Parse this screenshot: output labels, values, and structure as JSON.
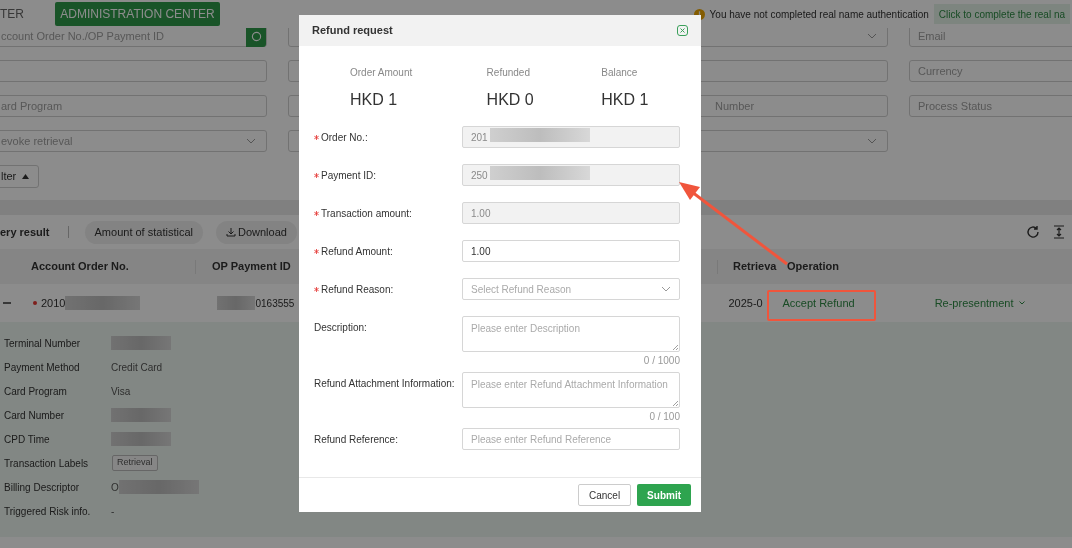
{
  "top_bar": {
    "cut_label": "TER",
    "admin_button": "ADMINISTRATION CENTER",
    "notice": "You have not completed real name authentication",
    "notice_link": "Click to complete the real na"
  },
  "filters": {
    "column_1": [
      {
        "kind": "search",
        "placeholder": "ccount Order No./OP Payment ID"
      },
      {
        "kind": "text"
      },
      {
        "kind": "text",
        "placeholder": "ard Program"
      },
      {
        "kind": "select",
        "placeholder": "evoke retrieval"
      }
    ],
    "column_3": [
      {
        "kind": "select"
      },
      {
        "kind": "text"
      },
      {
        "kind": "text",
        "placeholder": "Number"
      },
      {
        "kind": "select"
      }
    ],
    "column_4": [
      {
        "placeholder": "Email"
      },
      {
        "placeholder": "Currency"
      },
      {
        "placeholder": "Process Status"
      }
    ],
    "filter_toggle": {
      "label": "lter",
      "expanded": true
    }
  },
  "toolbar": {
    "title": "ery result",
    "buttons": [
      {
        "label": "Amount of statistical",
        "kind": "plain"
      },
      {
        "label": "Download",
        "kind": "download"
      }
    ]
  },
  "table": {
    "columns": [
      "Account Order No.",
      "OP Payment ID",
      "Retrieva",
      "Operation"
    ],
    "row": {
      "expanded": true,
      "order_no": "2010",
      "payment_id": "0163555",
      "retrieval": "2025-0",
      "actions": [
        "Accept Refund",
        "Re-presentment"
      ]
    },
    "details": [
      {
        "label": "Terminal Number",
        "kind": "redacted"
      },
      {
        "label": "Payment Method",
        "kind": "text",
        "value": "Credit Card"
      },
      {
        "label": "Card Program",
        "kind": "text",
        "value": "Visa"
      },
      {
        "label": "Card Number",
        "kind": "redacted"
      },
      {
        "label": "CPD Time",
        "kind": "redacted"
      },
      {
        "label": "Transaction Labels",
        "kind": "tag",
        "value": "Retrieval"
      },
      {
        "label": "Billing Descriptor",
        "kind": "partial",
        "value": "O"
      },
      {
        "label": "Triggered Risk info.",
        "kind": "text",
        "value": "-"
      }
    ]
  },
  "dialog": {
    "title": "Refund request",
    "summary": [
      {
        "label": "Order Amount",
        "value": "HKD 1"
      },
      {
        "label": "Refunded",
        "value": "HKD 0"
      },
      {
        "label": "Balance",
        "value": "HKD 1"
      }
    ],
    "fields": [
      {
        "label": "Order No.:",
        "required": true,
        "kind": "input",
        "disabled": true,
        "value": "201",
        "redacted": true
      },
      {
        "label": "Payment ID:",
        "required": true,
        "kind": "input",
        "disabled": true,
        "value": "250",
        "redacted": true
      },
      {
        "label": "Transaction amount:",
        "required": true,
        "kind": "input",
        "disabled": true,
        "value": "1.00",
        "redacted": false
      },
      {
        "label": "Refund Amount:",
        "required": true,
        "kind": "input",
        "disabled": false,
        "value": "1.00",
        "redacted": false
      },
      {
        "label": "Refund Reason:",
        "required": true,
        "kind": "select",
        "placeholder": "Select Refund Reason"
      },
      {
        "label": "Description:",
        "required": false,
        "kind": "textarea",
        "placeholder": "Please enter Description",
        "counter": "0 / 1000"
      },
      {
        "label": "Refund Attachment Information:",
        "required": false,
        "kind": "textarea",
        "placeholder": "Please enter Refund Attachment Information",
        "counter": "0 / 100"
      },
      {
        "label": "Refund Reference:",
        "required": false,
        "kind": "input",
        "disabled": false,
        "placeholder": "Please enter Refund Reference",
        "redacted": false
      }
    ],
    "buttons": [
      {
        "label": "Cancel",
        "kind": "secondary"
      },
      {
        "label": "Submit",
        "kind": "primary"
      }
    ]
  }
}
